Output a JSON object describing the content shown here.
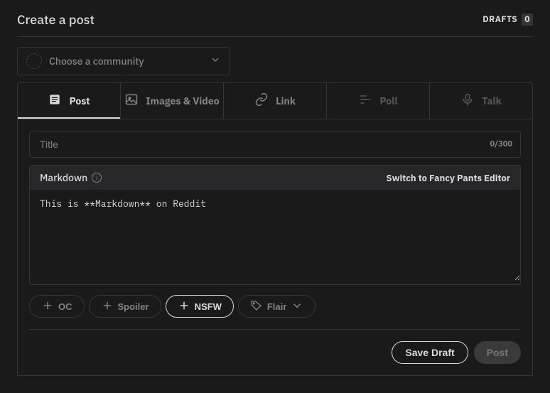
{
  "header": {
    "title": "Create a post",
    "drafts_label": "DRAFTS",
    "drafts_count": "0"
  },
  "community": {
    "placeholder": "Choose a community"
  },
  "tabs": {
    "post": "Post",
    "images": "Images & Video",
    "link": "Link",
    "poll": "Poll",
    "talk": "Talk"
  },
  "title_field": {
    "placeholder": "Title",
    "value": "",
    "counter": "0/300"
  },
  "editor": {
    "mode_label": "Markdown",
    "switch_label": "Switch to Fancy Pants Editor",
    "body_value": "This is **Markdown** on Reddit"
  },
  "tags": {
    "oc": "OC",
    "spoiler": "Spoiler",
    "nsfw": "NSFW",
    "flair": "Flair"
  },
  "actions": {
    "save_draft": "Save Draft",
    "post": "Post"
  }
}
